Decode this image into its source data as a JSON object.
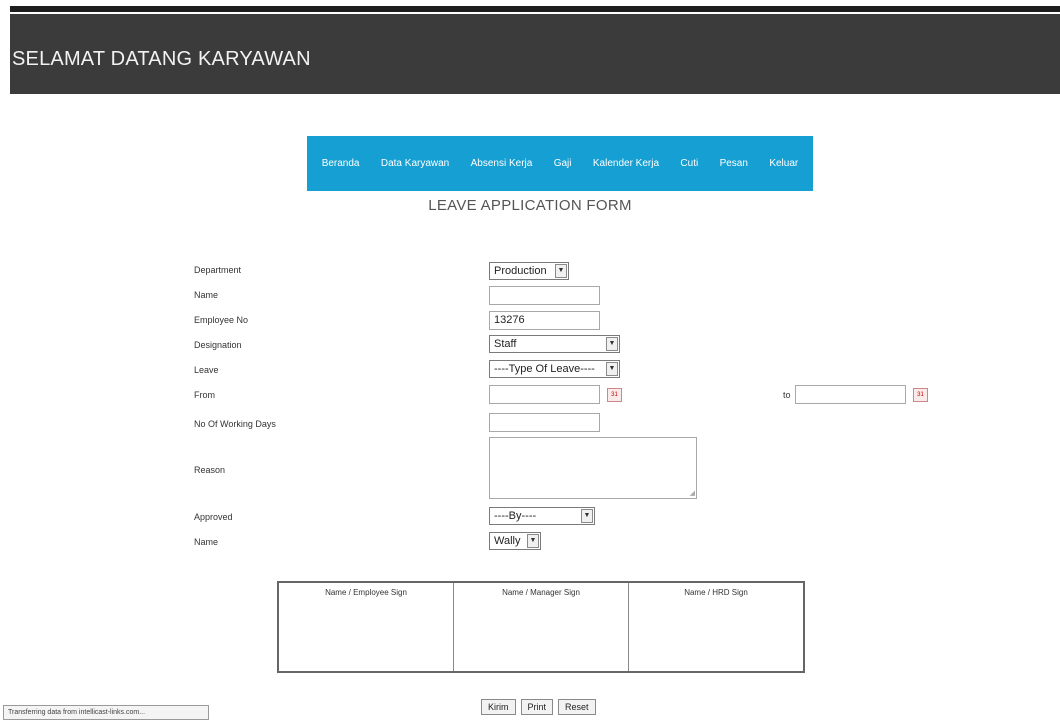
{
  "header": {
    "title": "SELAMAT DATANG KARYAWAN"
  },
  "nav": {
    "items": [
      "Beranda",
      "Data Karyawan",
      "Absensi Kerja",
      "Gaji",
      "Kalender Kerja",
      "Cuti",
      "Pesan",
      "Keluar"
    ]
  },
  "form": {
    "title": "LEAVE APPLICATION FORM",
    "labels": {
      "department": "Department",
      "name": "Name",
      "employee_no": "Employee No",
      "designation": "Designation",
      "leave": "Leave",
      "from": "From",
      "to": "to",
      "working_days": "No Of Working Days",
      "reason": "Reason",
      "approved": "Approved",
      "name2": "Name"
    },
    "values": {
      "department": "Production",
      "name": "",
      "employee_no": "13276",
      "designation": "Staff",
      "leave": "----Type Of Leave----",
      "from": "",
      "to": "",
      "working_days": "",
      "reason": "",
      "approved": "----By----",
      "name2": "Wally"
    },
    "calendar_icon": "calendar-icon"
  },
  "signatures": [
    "Name / Employee Sign",
    "Name / Manager Sign",
    "Name / HRD Sign"
  ],
  "buttons": {
    "submit": "Kirim",
    "print": "Print",
    "reset": "Reset"
  },
  "status_bar": "Transferring data from intellicast-links.com...",
  "colors": {
    "header_bg": "#3b3b3b",
    "nav_bg": "#169fd2"
  }
}
